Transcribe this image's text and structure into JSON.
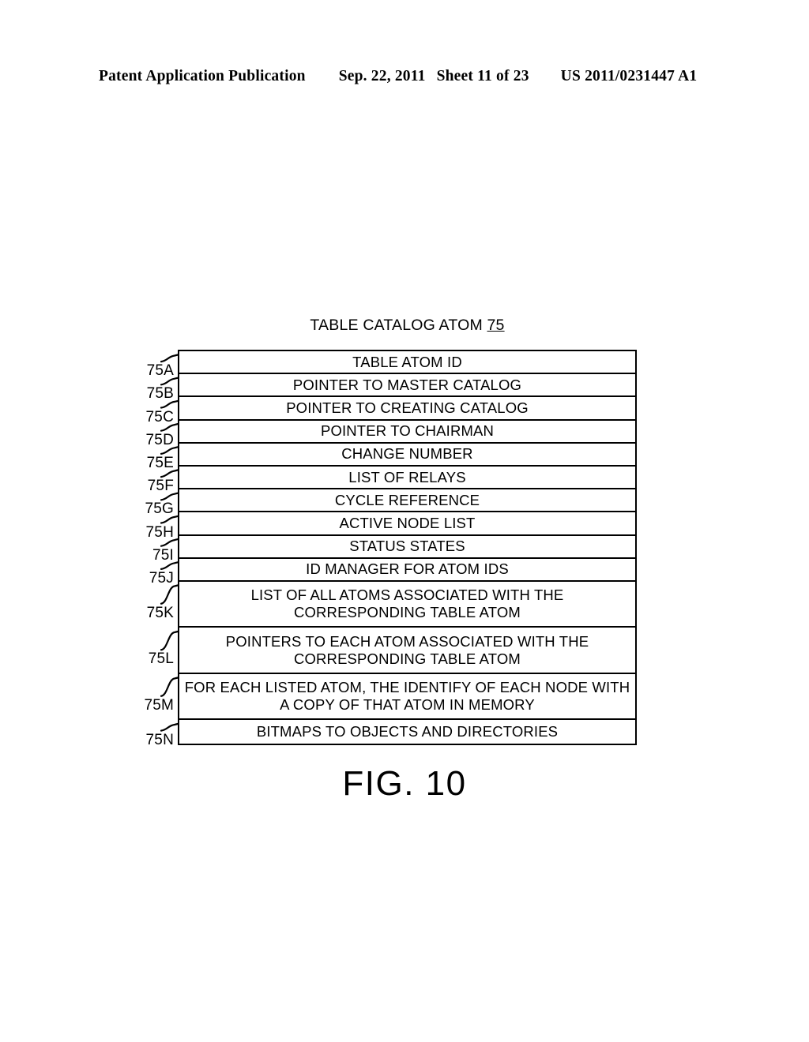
{
  "header": {
    "publication": "Patent Application Publication",
    "date": "Sep. 22, 2011",
    "sheet": "Sheet 11 of 23",
    "pub_number": "US 2011/0231447 A1"
  },
  "figure": {
    "title_text": "TABLE CATALOG ATOM",
    "title_ref": "75",
    "caption": "FIG. 10"
  },
  "table": {
    "rows": [
      {
        "ref": "75A",
        "text": "TABLE ATOM ID",
        "lines": 1
      },
      {
        "ref": "75B",
        "text": "POINTER TO MASTER CATALOG",
        "lines": 1
      },
      {
        "ref": "75C",
        "text": "POINTER TO CREATING CATALOG",
        "lines": 1
      },
      {
        "ref": "75D",
        "text": "POINTER TO CHAIRMAN",
        "lines": 1
      },
      {
        "ref": "75E",
        "text": "CHANGE NUMBER",
        "lines": 1
      },
      {
        "ref": "75F",
        "text": "LIST OF RELAYS",
        "lines": 1
      },
      {
        "ref": "75G",
        "text": "CYCLE REFERENCE",
        "lines": 1
      },
      {
        "ref": "75H",
        "text": "ACTIVE NODE LIST",
        "lines": 1
      },
      {
        "ref": "75I",
        "text": "STATUS STATES",
        "lines": 1
      },
      {
        "ref": "75J",
        "text": "ID MANAGER FOR ATOM IDS",
        "lines": 1
      },
      {
        "ref": "75K",
        "text": "LIST OF ALL ATOMS ASSOCIATED WITH THE CORRESPONDING TABLE ATOM",
        "lines": 2
      },
      {
        "ref": "75L",
        "text": "POINTERS TO EACH ATOM ASSOCIATED WITH THE CORRESPONDING TABLE ATOM",
        "lines": 2
      },
      {
        "ref": "75M",
        "text": "FOR EACH LISTED ATOM, THE IDENTIFY OF EACH NODE WITH A COPY OF THAT ATOM IN MEMORY",
        "lines": 2
      },
      {
        "ref": "75N",
        "text": "BITMAPS TO OBJECTS AND DIRECTORIES",
        "lines": 1
      }
    ]
  },
  "colors": {
    "ink": "#000000",
    "paper": "#ffffff"
  }
}
